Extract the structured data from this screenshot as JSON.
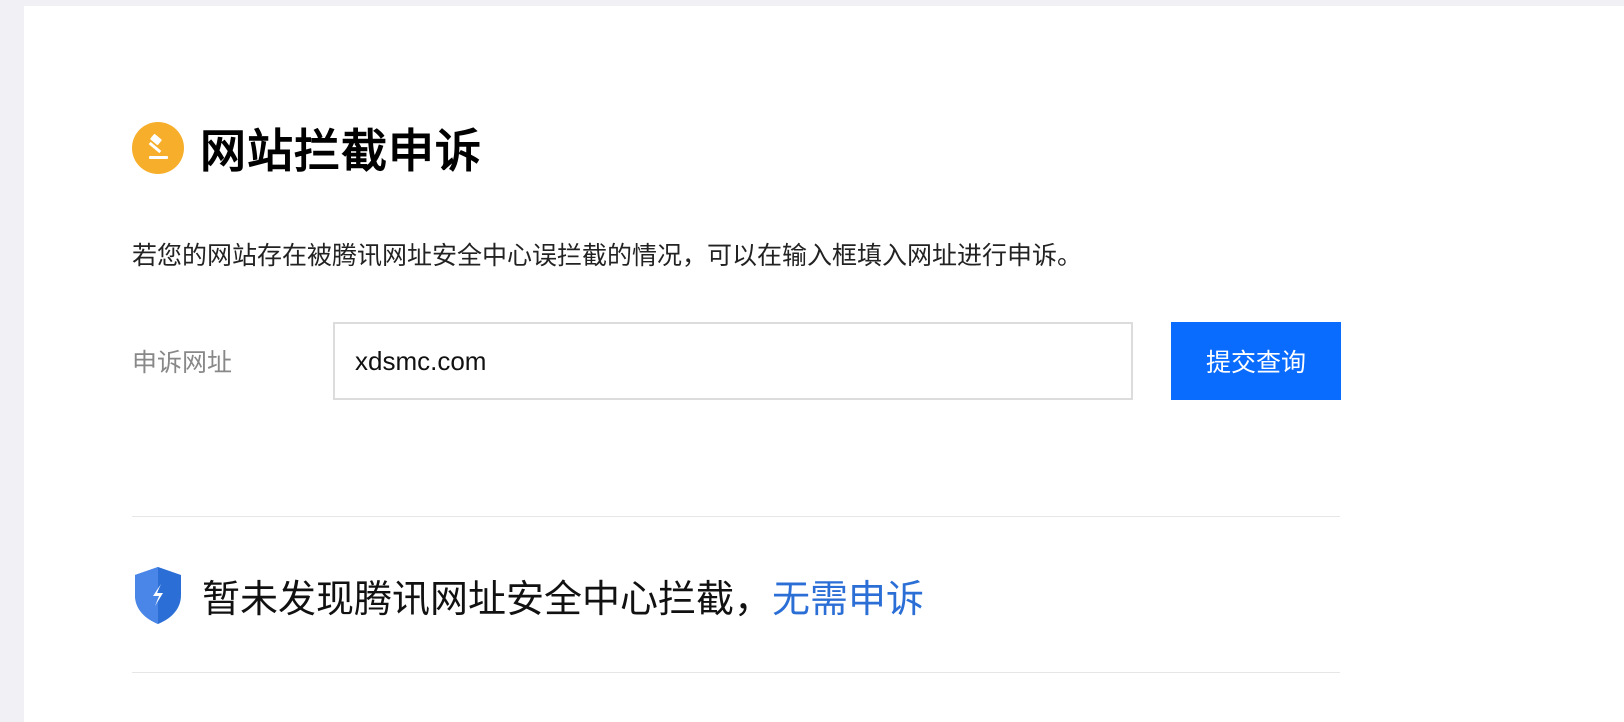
{
  "header": {
    "title": "网站拦截申诉",
    "icon": "gavel-icon",
    "icon_color": "#f7ae2b"
  },
  "description": "若您的网站存在被腾讯网址安全中心误拦截的情况，可以在输入框填入网址进行申诉。",
  "form": {
    "label": "申诉网址",
    "input_value": "xdsmc.com",
    "submit_label": "提交查询",
    "submit_color": "#0a6cff"
  },
  "result": {
    "icon": "shield-icon",
    "icon_color": "#2b6fd6",
    "message": "暂未发现腾讯网址安全中心拦截，",
    "link_text": "无需申诉",
    "link_color": "#2b6fd6"
  }
}
